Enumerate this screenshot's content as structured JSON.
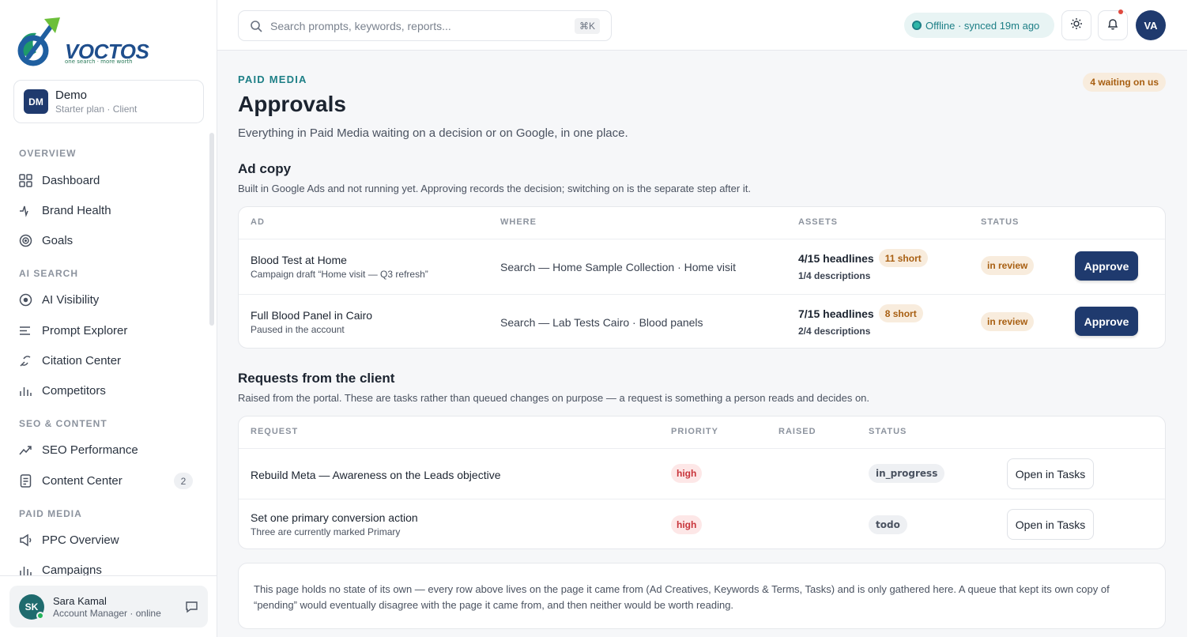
{
  "brand": {
    "logo_text": "VOCTOS",
    "tagline": "one search · more worth"
  },
  "workspace": {
    "initials": "DM",
    "name": "Demo",
    "plan": "Starter plan · Client"
  },
  "sidebar": {
    "sections": [
      {
        "title": "OVERVIEW",
        "items": [
          {
            "label": "Dashboard",
            "icon": "grid-icon"
          },
          {
            "label": "Brand Health",
            "icon": "pulse-icon"
          },
          {
            "label": "Goals",
            "icon": "target-icon"
          }
        ]
      },
      {
        "title": "AI SEARCH",
        "items": [
          {
            "label": "AI Visibility",
            "icon": "eye-circle-icon"
          },
          {
            "label": "Prompt Explorer",
            "icon": "lines-icon"
          },
          {
            "label": "Citation Center",
            "icon": "link-icon"
          },
          {
            "label": "Competitors",
            "icon": "bars-icon"
          }
        ]
      },
      {
        "title": "SEO & CONTENT",
        "items": [
          {
            "label": "SEO Performance",
            "icon": "trend-icon"
          },
          {
            "label": "Content Center",
            "icon": "document-icon",
            "count": "2"
          }
        ]
      },
      {
        "title": "PAID MEDIA",
        "items": [
          {
            "label": "PPC Overview",
            "icon": "megaphone-icon"
          },
          {
            "label": "Campaigns",
            "icon": "bars-icon"
          }
        ]
      }
    ]
  },
  "user": {
    "initials": "SK",
    "name": "Sara Kamal",
    "role": "Account Manager · online"
  },
  "topbar": {
    "search_placeholder": "Search prompts, keywords, reports...",
    "shortcut": "⌘K",
    "status_text": "Offline · synced 19m ago",
    "avatar": "VA"
  },
  "page": {
    "eyebrow": "PAID MEDIA",
    "title": "Approvals",
    "subtitle": "Everything in Paid Media waiting on a decision or on Google, in one place.",
    "waiting_badge": "4 waiting on us"
  },
  "ad_copy": {
    "title": "Ad copy",
    "description": "Built in Google Ads and not running yet. Approving records the decision; switching on is the separate step after it.",
    "headers": {
      "ad": "AD",
      "where": "WHERE",
      "assets": "ASSETS",
      "status": "STATUS"
    },
    "rows": [
      {
        "name": "Blood Test at Home",
        "sub": "Campaign draft “Home visit — Q3 refresh”",
        "where": "Search — Home Sample Collection · Home visit",
        "headlines": "4/15 headlines",
        "short": "11 short",
        "descriptions": "1/4 descriptions",
        "status": "in review",
        "action": "Approve"
      },
      {
        "name": "Full Blood Panel in Cairo",
        "sub": "Paused in the account",
        "where": "Search — Lab Tests Cairo · Blood panels",
        "headlines": "7/15 headlines",
        "short": "8 short",
        "descriptions": "2/4 descriptions",
        "status": "in review",
        "action": "Approve"
      }
    ]
  },
  "requests": {
    "title": "Requests from the client",
    "description": "Raised from the portal. These are tasks rather than queued changes on purpose — a request is something a person reads and decides on.",
    "headers": {
      "request": "REQUEST",
      "priority": "PRIORITY",
      "raised": "RAISED",
      "status": "STATUS"
    },
    "rows": [
      {
        "name": "Rebuild Meta — Awareness on the Leads objective",
        "sub": "",
        "priority": "high",
        "raised": "",
        "status": "in_progress",
        "action": "Open in Tasks"
      },
      {
        "name": "Set one primary conversion action",
        "sub": "Three are currently marked Primary",
        "priority": "high",
        "raised": "",
        "status": "todo",
        "action": "Open in Tasks"
      }
    ]
  },
  "footnote": "This page holds no state of its own — every row above lives on the page it came from (Ad Creatives, Keywords & Terms, Tasks) and is only gathered here. A queue that kept its own copy of “pending” would eventually disagree with the page it came from, and then neither would be worth reading.",
  "colors": {
    "brand_navy": "#1f3a6e",
    "accent_teal": "#1d7f86",
    "warning_bg": "#f8ecdd",
    "warning_text": "#a85f12",
    "danger_bg": "#fde7e7",
    "danger_text": "#c8343a"
  }
}
